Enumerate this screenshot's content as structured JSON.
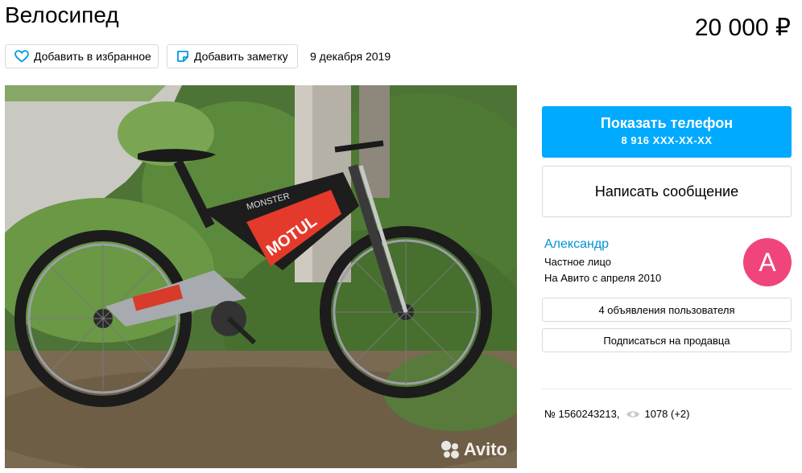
{
  "item": {
    "title": "Велосипед",
    "price": "20 000 ₽",
    "date": "9 декабря 2019"
  },
  "actions": {
    "favorite_label": "Добавить в избранное",
    "note_label": "Добавить заметку"
  },
  "photo": {
    "watermark": "Avito",
    "frame_text": "MONSTER",
    "brand_text": "MOTUL"
  },
  "contact": {
    "phone_label": "Показать телефон",
    "phone_number": "8 916 XXX-XX-XX",
    "message_label": "Написать сообщение"
  },
  "seller": {
    "name": "Александр",
    "type": "Частное лицо",
    "since": "На Авито с апреля 2010",
    "avatar_letter": "А",
    "avatar_color": "#f0457a",
    "ads_label": "4 объявления пользователя",
    "subscribe_label": "Подписаться на продавца"
  },
  "meta": {
    "ad_number": "№ 1560243213,",
    "views": "1078 (+2)"
  },
  "colors": {
    "accent": "#00aaff",
    "link": "#0091d9"
  }
}
